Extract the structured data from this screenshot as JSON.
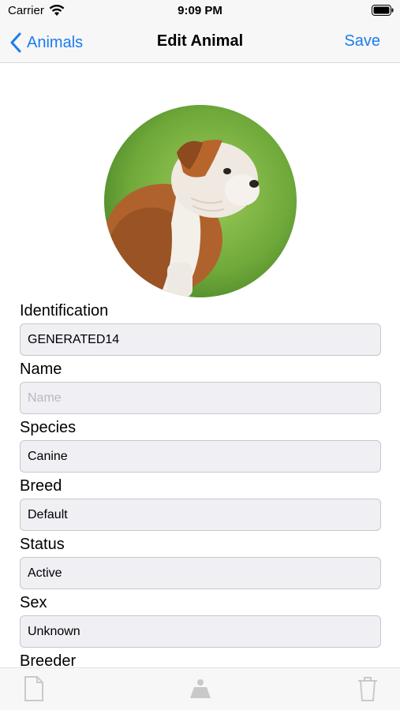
{
  "status_bar": {
    "carrier": "Carrier",
    "time": "9:09 PM",
    "icons": [
      "wifi-icon",
      "battery-icon"
    ]
  },
  "nav": {
    "back_label": "Animals",
    "title": "Edit Animal",
    "save_label": "Save",
    "accent_color": "#1a7cf0"
  },
  "avatar": {
    "icon": "bulldog-photo"
  },
  "form": {
    "identification": {
      "label": "Identification",
      "value": "GENERATED14"
    },
    "name": {
      "label": "Name",
      "value": "",
      "placeholder": "Name"
    },
    "species": {
      "label": "Species",
      "value": "Canine"
    },
    "breed": {
      "label": "Breed",
      "value": "Default"
    },
    "status": {
      "label": "Status",
      "value": "Active"
    },
    "sex": {
      "label": "Sex",
      "value": "Unknown"
    },
    "breeder": {
      "label": "Breeder"
    }
  },
  "toolbar": {
    "icons": [
      "document-icon",
      "weight-scale-icon",
      "trash-icon"
    ]
  }
}
